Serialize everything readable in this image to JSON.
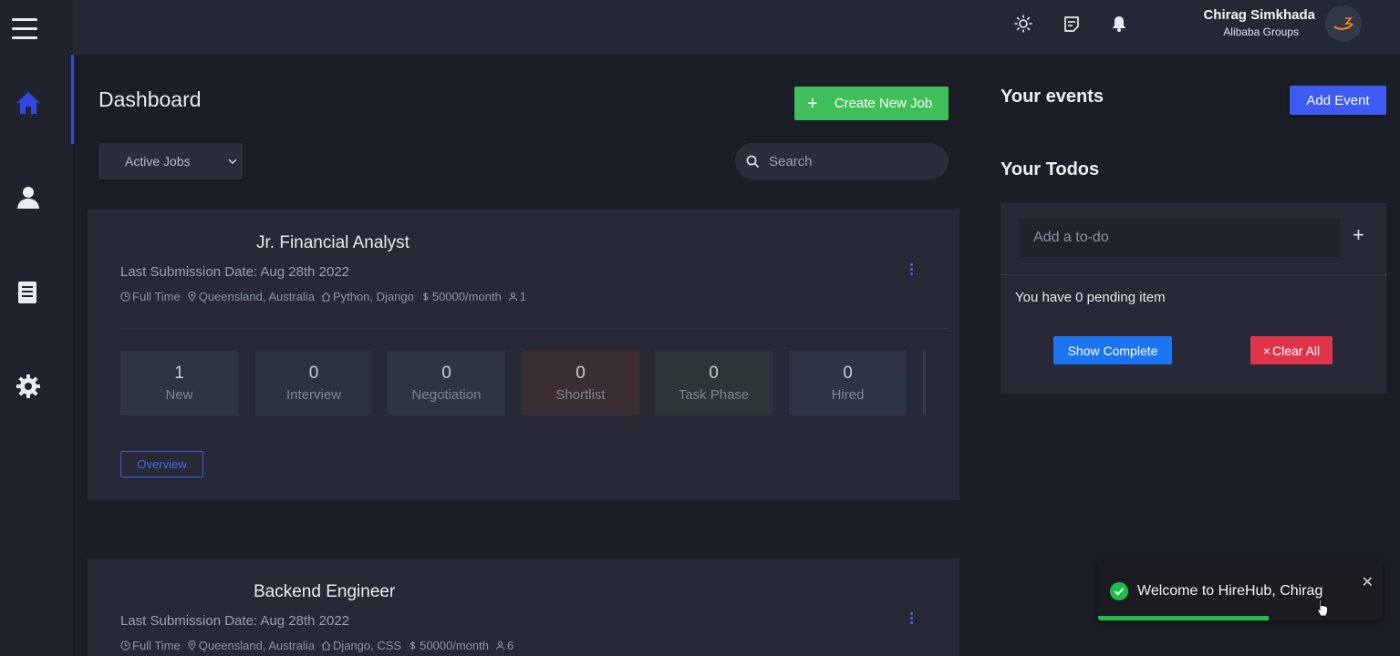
{
  "header": {
    "user_name": "Chirag Simkhada",
    "user_company": "Alibaba Groups",
    "icons": [
      "menu-icon",
      "sun-icon",
      "notes-icon",
      "bell-icon"
    ]
  },
  "sidebar": {
    "items": [
      {
        "name": "home",
        "icon": "home-icon",
        "active": true
      },
      {
        "name": "users",
        "icon": "user-icon",
        "active": false
      },
      {
        "name": "documents",
        "icon": "document-icon",
        "active": false
      },
      {
        "name": "settings",
        "icon": "gear-icon",
        "active": false
      }
    ]
  },
  "main": {
    "title": "Dashboard",
    "create_button": "Create New Job",
    "filter_value": "Active Jobs",
    "search_placeholder": "Search",
    "jobs": [
      {
        "title": "Jr. Financial Analyst",
        "submission": "Last Submission Date: Aug 28th 2022",
        "type": "Full Time",
        "location": "Queensland, Australia",
        "skills": "Python, Django",
        "salary": "50000/month",
        "applicants": "1",
        "stages": [
          {
            "count": "1",
            "label": "New"
          },
          {
            "count": "0",
            "label": "Interview"
          },
          {
            "count": "0",
            "label": "Negotiation"
          },
          {
            "count": "0",
            "label": "Shortlist"
          },
          {
            "count": "0",
            "label": "Task Phase"
          },
          {
            "count": "0",
            "label": "Hired"
          }
        ],
        "overview_label": "Overview"
      },
      {
        "title": "Backend Engineer",
        "submission": "Last Submission Date: Aug 28th 2022",
        "type": "Full Time",
        "location": "Queensland, Australia",
        "skills": "Django, CSS",
        "salary": "50000/month",
        "applicants": "6"
      }
    ]
  },
  "events": {
    "title": "Your events",
    "add_button": "Add Event"
  },
  "todos": {
    "title": "Your Todos",
    "input_placeholder": "Add a to-do",
    "add_symbol": "+",
    "pending_text": "You have 0 pending item",
    "show_complete": "Show Complete",
    "clear_all": "Clear All"
  },
  "toast": {
    "message": "Welcome to HireHub, Chirag",
    "progress": 0.6
  },
  "colors": {
    "accent": "#3d5bf2",
    "success": "#3fbe5a",
    "danger": "#e0344c",
    "background": "#1c1e27"
  }
}
